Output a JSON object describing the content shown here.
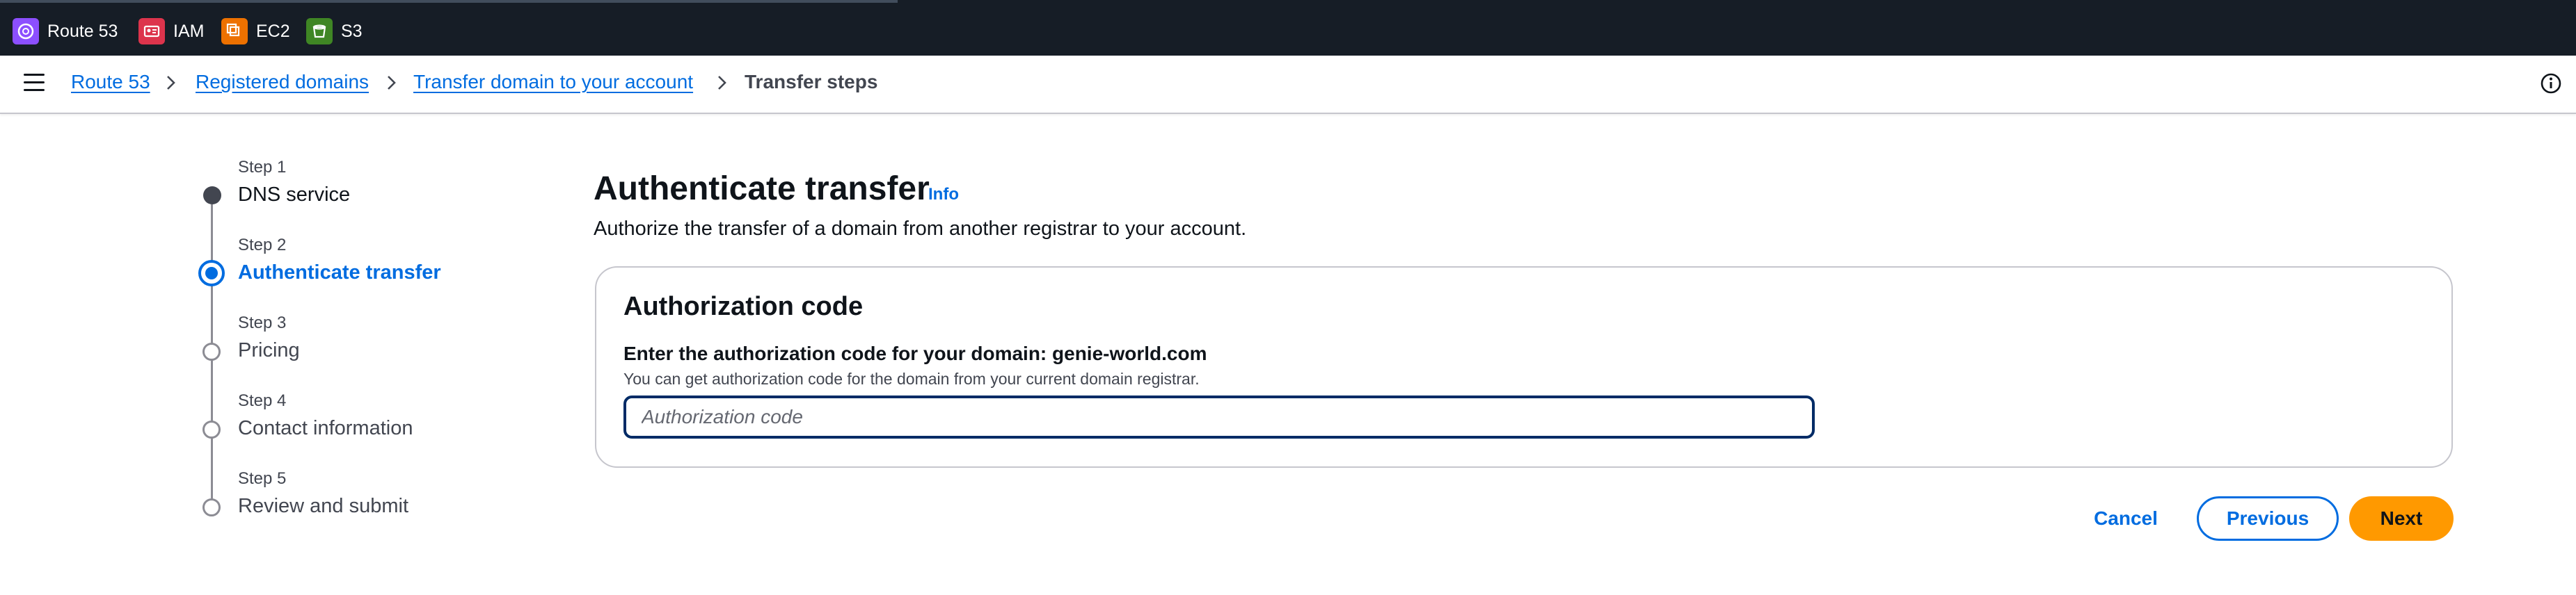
{
  "services": [
    {
      "label": "Route 53",
      "icon": "route53-icon",
      "color": "#8c4fff"
    },
    {
      "label": "IAM",
      "icon": "iam-icon",
      "color": "#dd344c"
    },
    {
      "label": "EC2",
      "icon": "ec2-icon",
      "color": "#ed7100"
    },
    {
      "label": "S3",
      "icon": "s3-icon",
      "color": "#3f8624"
    }
  ],
  "breadcrumb": {
    "items": [
      "Route 53",
      "Registered domains",
      "Transfer domain to your account"
    ],
    "current": "Transfer steps"
  },
  "steps": [
    {
      "step": "Step 1",
      "title": "DNS service",
      "state": "completed"
    },
    {
      "step": "Step 2",
      "title": "Authenticate transfer",
      "state": "active"
    },
    {
      "step": "Step 3",
      "title": "Pricing",
      "state": "upcoming"
    },
    {
      "step": "Step 4",
      "title": "Contact information",
      "state": "upcoming"
    },
    {
      "step": "Step 5",
      "title": "Review and submit",
      "state": "upcoming"
    }
  ],
  "main": {
    "title": "Authenticate transfer",
    "info_label": "Info",
    "subtitle": "Authorize the transfer of a domain from another registrar to your account."
  },
  "panel": {
    "title": "Authorization code",
    "field_label": "Enter the authorization code for your domain: genie-world.com",
    "field_description": "You can get authorization code for the domain from your current domain registrar.",
    "input_value": "",
    "input_placeholder": "Authorization code"
  },
  "actions": {
    "cancel": "Cancel",
    "previous": "Previous",
    "next": "Next"
  },
  "colors": {
    "link": "#006ce0",
    "primary_button": "#ff9900",
    "topbar": "#161d26"
  }
}
